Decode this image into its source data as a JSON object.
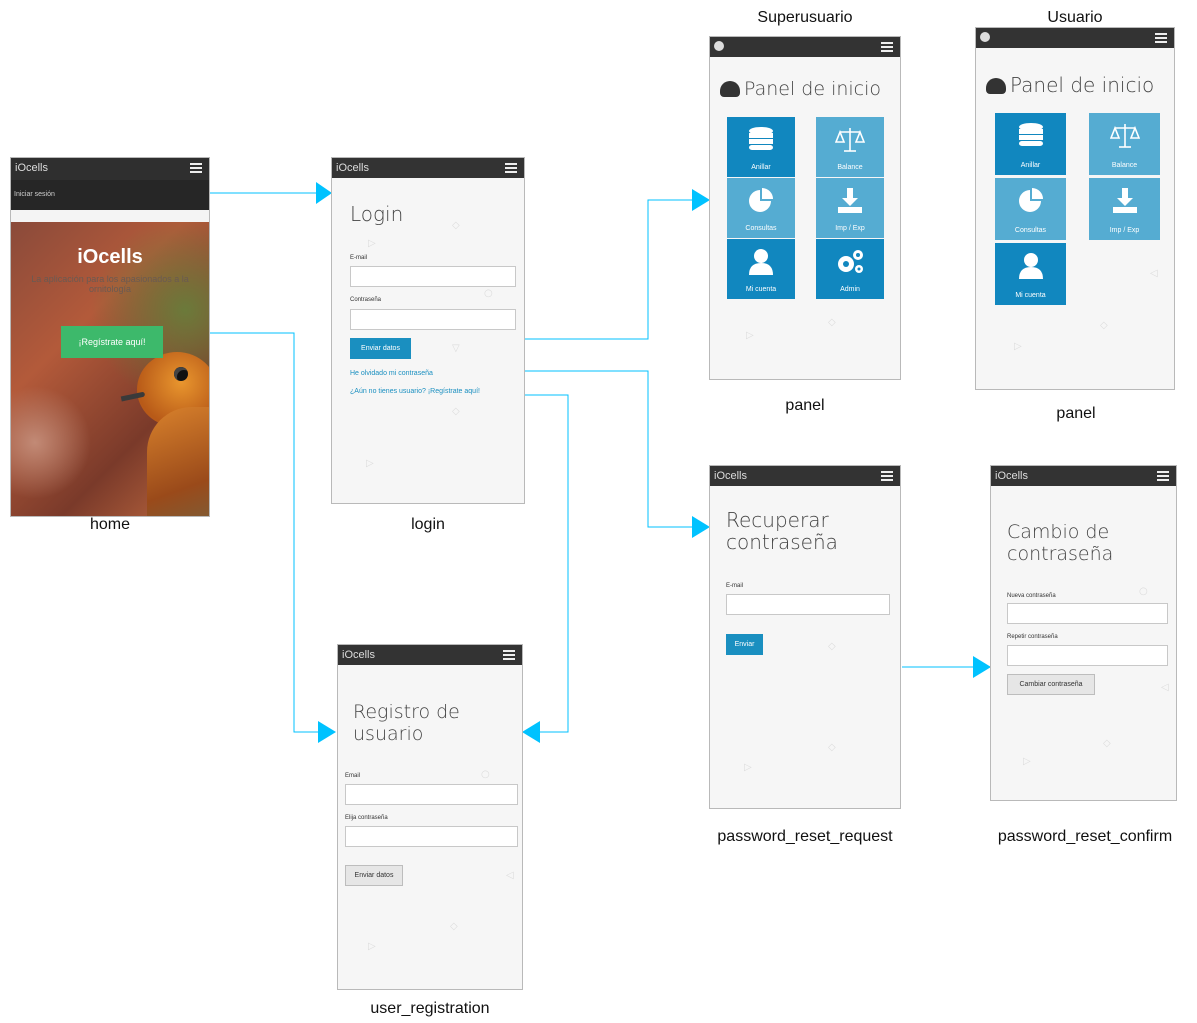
{
  "colors": {
    "arrow": "#00c2ff",
    "topbar": "#333333",
    "tile_dark": "#1187bf",
    "tile_light": "#55acd2",
    "primary_button": "#1a8fc0",
    "register_button": "#3db96b"
  },
  "captions": {
    "home": "home",
    "login": "login",
    "user_registration": "user_registration",
    "panel_super": "panel",
    "panel_user": "panel",
    "password_reset_request": "password_reset_request",
    "password_reset_confirm": "password_reset_confirm"
  },
  "group_labels": {
    "superuser": "Superusuario",
    "user": "Usuario"
  },
  "home": {
    "app_name": "iOcells",
    "menu_item": "Iniciar sesión",
    "hero_title": "iOcells",
    "hero_subtitle": "La aplicación para los apasionados a la ornitología",
    "register_button": "¡Regístrate aquí!"
  },
  "login": {
    "app_name": "iOcells",
    "title": "Login",
    "email_label": "E-mail",
    "password_label": "Contraseña",
    "submit_button": "Enviar datos",
    "forgot_link": "He olvidado mi contraseña",
    "register_link": "¿Aún no tienes usuario? ¡Regístrate aquí!"
  },
  "registration": {
    "app_name": "iOcells",
    "title_line1": "Registro de",
    "title_line2": "usuario",
    "email_label": "Email",
    "password_label": "Elija contraseña",
    "submit_button": "Enviar datos"
  },
  "panel_super": {
    "title": "Panel de inicio",
    "tiles": [
      {
        "label": "Anillar",
        "icon": "database-icon",
        "tone": "dark"
      },
      {
        "label": "Balance",
        "icon": "scale-icon",
        "tone": "light"
      },
      {
        "label": "Consultas",
        "icon": "pie-chart-icon",
        "tone": "light"
      },
      {
        "label": "Imp / Exp",
        "icon": "download-icon",
        "tone": "light"
      },
      {
        "label": "Mi cuenta",
        "icon": "user-icon",
        "tone": "dark"
      },
      {
        "label": "Admin",
        "icon": "gears-icon",
        "tone": "dark"
      }
    ]
  },
  "panel_user": {
    "title": "Panel de inicio",
    "tiles": [
      {
        "label": "Anillar",
        "icon": "database-icon",
        "tone": "dark"
      },
      {
        "label": "Balance",
        "icon": "scale-icon",
        "tone": "light"
      },
      {
        "label": "Consultas",
        "icon": "pie-chart-icon",
        "tone": "light"
      },
      {
        "label": "Imp / Exp",
        "icon": "download-icon",
        "tone": "light"
      },
      {
        "label": "Mi cuenta",
        "icon": "user-icon",
        "tone": "dark"
      }
    ]
  },
  "reset_request": {
    "app_name": "iOcells",
    "title_line1": "Recuperar",
    "title_line2": "contraseña",
    "email_label": "E-mail",
    "submit_button": "Enviar"
  },
  "reset_confirm": {
    "app_name": "iOcells",
    "title_line1": "Cambio de",
    "title_line2": "contraseña",
    "new_password_label": "Nueva contraseña",
    "repeat_password_label": "Repetir contraseña",
    "submit_button": "Cambiar contraseña"
  }
}
